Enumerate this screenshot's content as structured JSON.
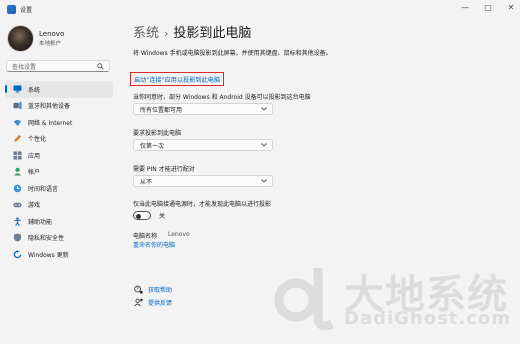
{
  "window": {
    "title": "设置",
    "controls": {
      "minimize": "—",
      "maximize": "□",
      "close": "✕"
    }
  },
  "profile": {
    "name": "Lenovo",
    "subtitle": "本地帐户"
  },
  "search": {
    "placeholder": "查找设置"
  },
  "sidebar": {
    "items": [
      {
        "label": "系统",
        "icon": "system-icon",
        "active": true
      },
      {
        "label": "蓝牙和其他设备",
        "icon": "bluetooth-icon"
      },
      {
        "label": "网络 & Internet",
        "icon": "network-icon"
      },
      {
        "label": "个性化",
        "icon": "personalization-icon"
      },
      {
        "label": "应用",
        "icon": "apps-icon"
      },
      {
        "label": "帐户",
        "icon": "accounts-icon"
      },
      {
        "label": "时间和语言",
        "icon": "time-language-icon"
      },
      {
        "label": "游戏",
        "icon": "gaming-icon"
      },
      {
        "label": "辅助功能",
        "icon": "accessibility-icon"
      },
      {
        "label": "隐私和安全性",
        "icon": "privacy-icon"
      },
      {
        "label": "Windows 更新",
        "icon": "windows-update-icon"
      }
    ]
  },
  "header": {
    "parent": "系统",
    "separator": "›",
    "current": "投影到此电脑"
  },
  "main": {
    "description": "将 Windows 手机或电脑投影到此屏幕，并使用其键盘、鼠标和其他设备。",
    "launch_link": "启动\"连接\"应用以投影到此电脑",
    "settings": [
      {
        "label": "当你同意时，部分 Windows 和 Android 设备可以投影到这台电脑",
        "value": "所有位置都可用"
      },
      {
        "label": "要求投影到此电脑",
        "value": "仅第一次"
      },
      {
        "label": "需要 PIN 才能进行配对",
        "value": "从不"
      }
    ],
    "power_label": "仅当此电脑接通电源时，才能发现此电脑以进行投影",
    "toggle_state": "关",
    "pc_name_label": "电脑名称",
    "pc_name_value": "Lenovo",
    "rename_link": "重命名你的电脑",
    "help_link": "获取帮助",
    "feedback_link": "提供反馈"
  },
  "watermark": {
    "big": "大地系统",
    "small": "DadiGhost.com"
  },
  "colors": {
    "accent": "#0067c0",
    "highlight_box": "#d92b2b",
    "background": "#f3f3f3"
  }
}
